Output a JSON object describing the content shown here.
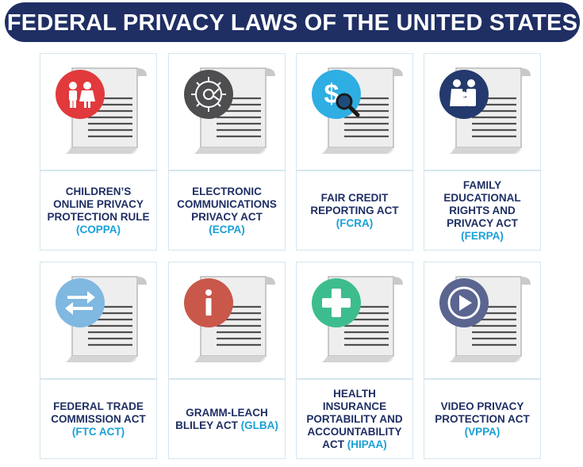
{
  "header": {
    "title": "FEDERAL PRIVACY LAWS OF THE UNITED STATES"
  },
  "colors": {
    "navy": "#1f2f64",
    "accent_blue": "#19a0d8",
    "card_border": "#d5e6ef"
  },
  "laws": [
    {
      "label": "CHILDREN’S ONLINE PRIVACY PROTECTION RULE",
      "abbr": "(COPPA)",
      "icon": "children-icon",
      "color": "#e2393c"
    },
    {
      "label": "ELECTRONIC COMMUNICATIONS PRIVACY ACT",
      "abbr": "(ECPA)",
      "icon": "circuit-gear-icon",
      "color": "#4e4e50"
    },
    {
      "label": "FAIR CREDIT REPORTING ACT",
      "abbr": "(FCRA)",
      "icon": "dollar-magnifier-icon",
      "color": "#2eaee3"
    },
    {
      "label": "FAMILY EDUCATIONAL RIGHTS AND PRIVACY ACT",
      "abbr": "(FERPA)",
      "icon": "family-icon",
      "color": "#243a6e"
    },
    {
      "label": "FEDERAL TRADE COMMISSION ACT",
      "abbr": "(FTC ACT)",
      "icon": "exchange-arrows-icon",
      "color": "#7fb8e0"
    },
    {
      "label": "GRAMM-LEACH BLILEY ACT",
      "abbr": "(GLBA)",
      "icon": "info-icon",
      "color": "#c9574a"
    },
    {
      "label": "HEALTH INSURANCE PORTABILITY AND ACCOUNTABILITY ACT",
      "abbr": "(HIPAA)",
      "icon": "medical-cross-icon",
      "color": "#3dbd8d"
    },
    {
      "label": "VIDEO PRIVACY PROTECTION ACT",
      "abbr": "(VPPA)",
      "icon": "play-icon",
      "color": "#5a6590"
    }
  ]
}
